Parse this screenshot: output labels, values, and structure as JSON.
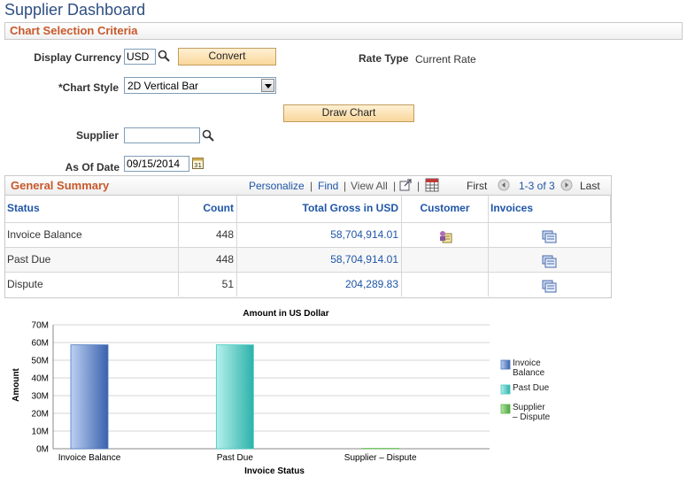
{
  "page": {
    "title": "Supplier Dashboard"
  },
  "criteria": {
    "section_title": "Chart Selection Criteria",
    "display_currency_label": "Display Currency",
    "display_currency_value": "USD",
    "convert_label": "Convert",
    "rate_type_label": "Rate Type",
    "rate_type_value": "Current Rate",
    "chart_style_label": "*Chart Style",
    "chart_style_value": "2D Vertical Bar",
    "draw_chart_label": "Draw Chart",
    "supplier_label": "Supplier",
    "supplier_value": "",
    "as_of_date_label": "As Of Date",
    "as_of_date_value": "09/15/2014"
  },
  "summary": {
    "title": "General Summary",
    "personalize": "Personalize",
    "find": "Find",
    "view_all": "View All",
    "first": "First",
    "range": "1-3 of 3",
    "last": "Last",
    "columns": [
      "Status",
      "Count",
      "Total Gross in USD",
      "Customer",
      "Invoices"
    ],
    "rows": [
      {
        "status": "Invoice Balance",
        "count": "448",
        "total": "58,704,914.01",
        "has_customer_icon": true
      },
      {
        "status": "Past Due",
        "count": "448",
        "total": "58,704,914.01",
        "has_customer_icon": false
      },
      {
        "status": "Dispute",
        "count": "51",
        "total": "204,289.83",
        "has_customer_icon": false
      }
    ]
  },
  "chart_data": {
    "type": "bar",
    "title": "Amount in US Dollar",
    "xlabel": "Invoice Status",
    "ylabel": "Amount",
    "categories": [
      "Invoice Balance",
      "Past Due",
      "Supplier – Dispute"
    ],
    "values": [
      58.7,
      58.7,
      0.2
    ],
    "yticks": [
      "0M",
      "10M",
      "20M",
      "30M",
      "40M",
      "50M",
      "60M",
      "70M"
    ],
    "ylim": [
      0,
      70
    ],
    "grid": true,
    "legend_position": "right",
    "legend": [
      "Invoice Balance",
      "Past Due",
      "Supplier – Dispute"
    ],
    "colors": [
      "#4a76c0",
      "#3fc7bf",
      "#5cb84a"
    ]
  }
}
